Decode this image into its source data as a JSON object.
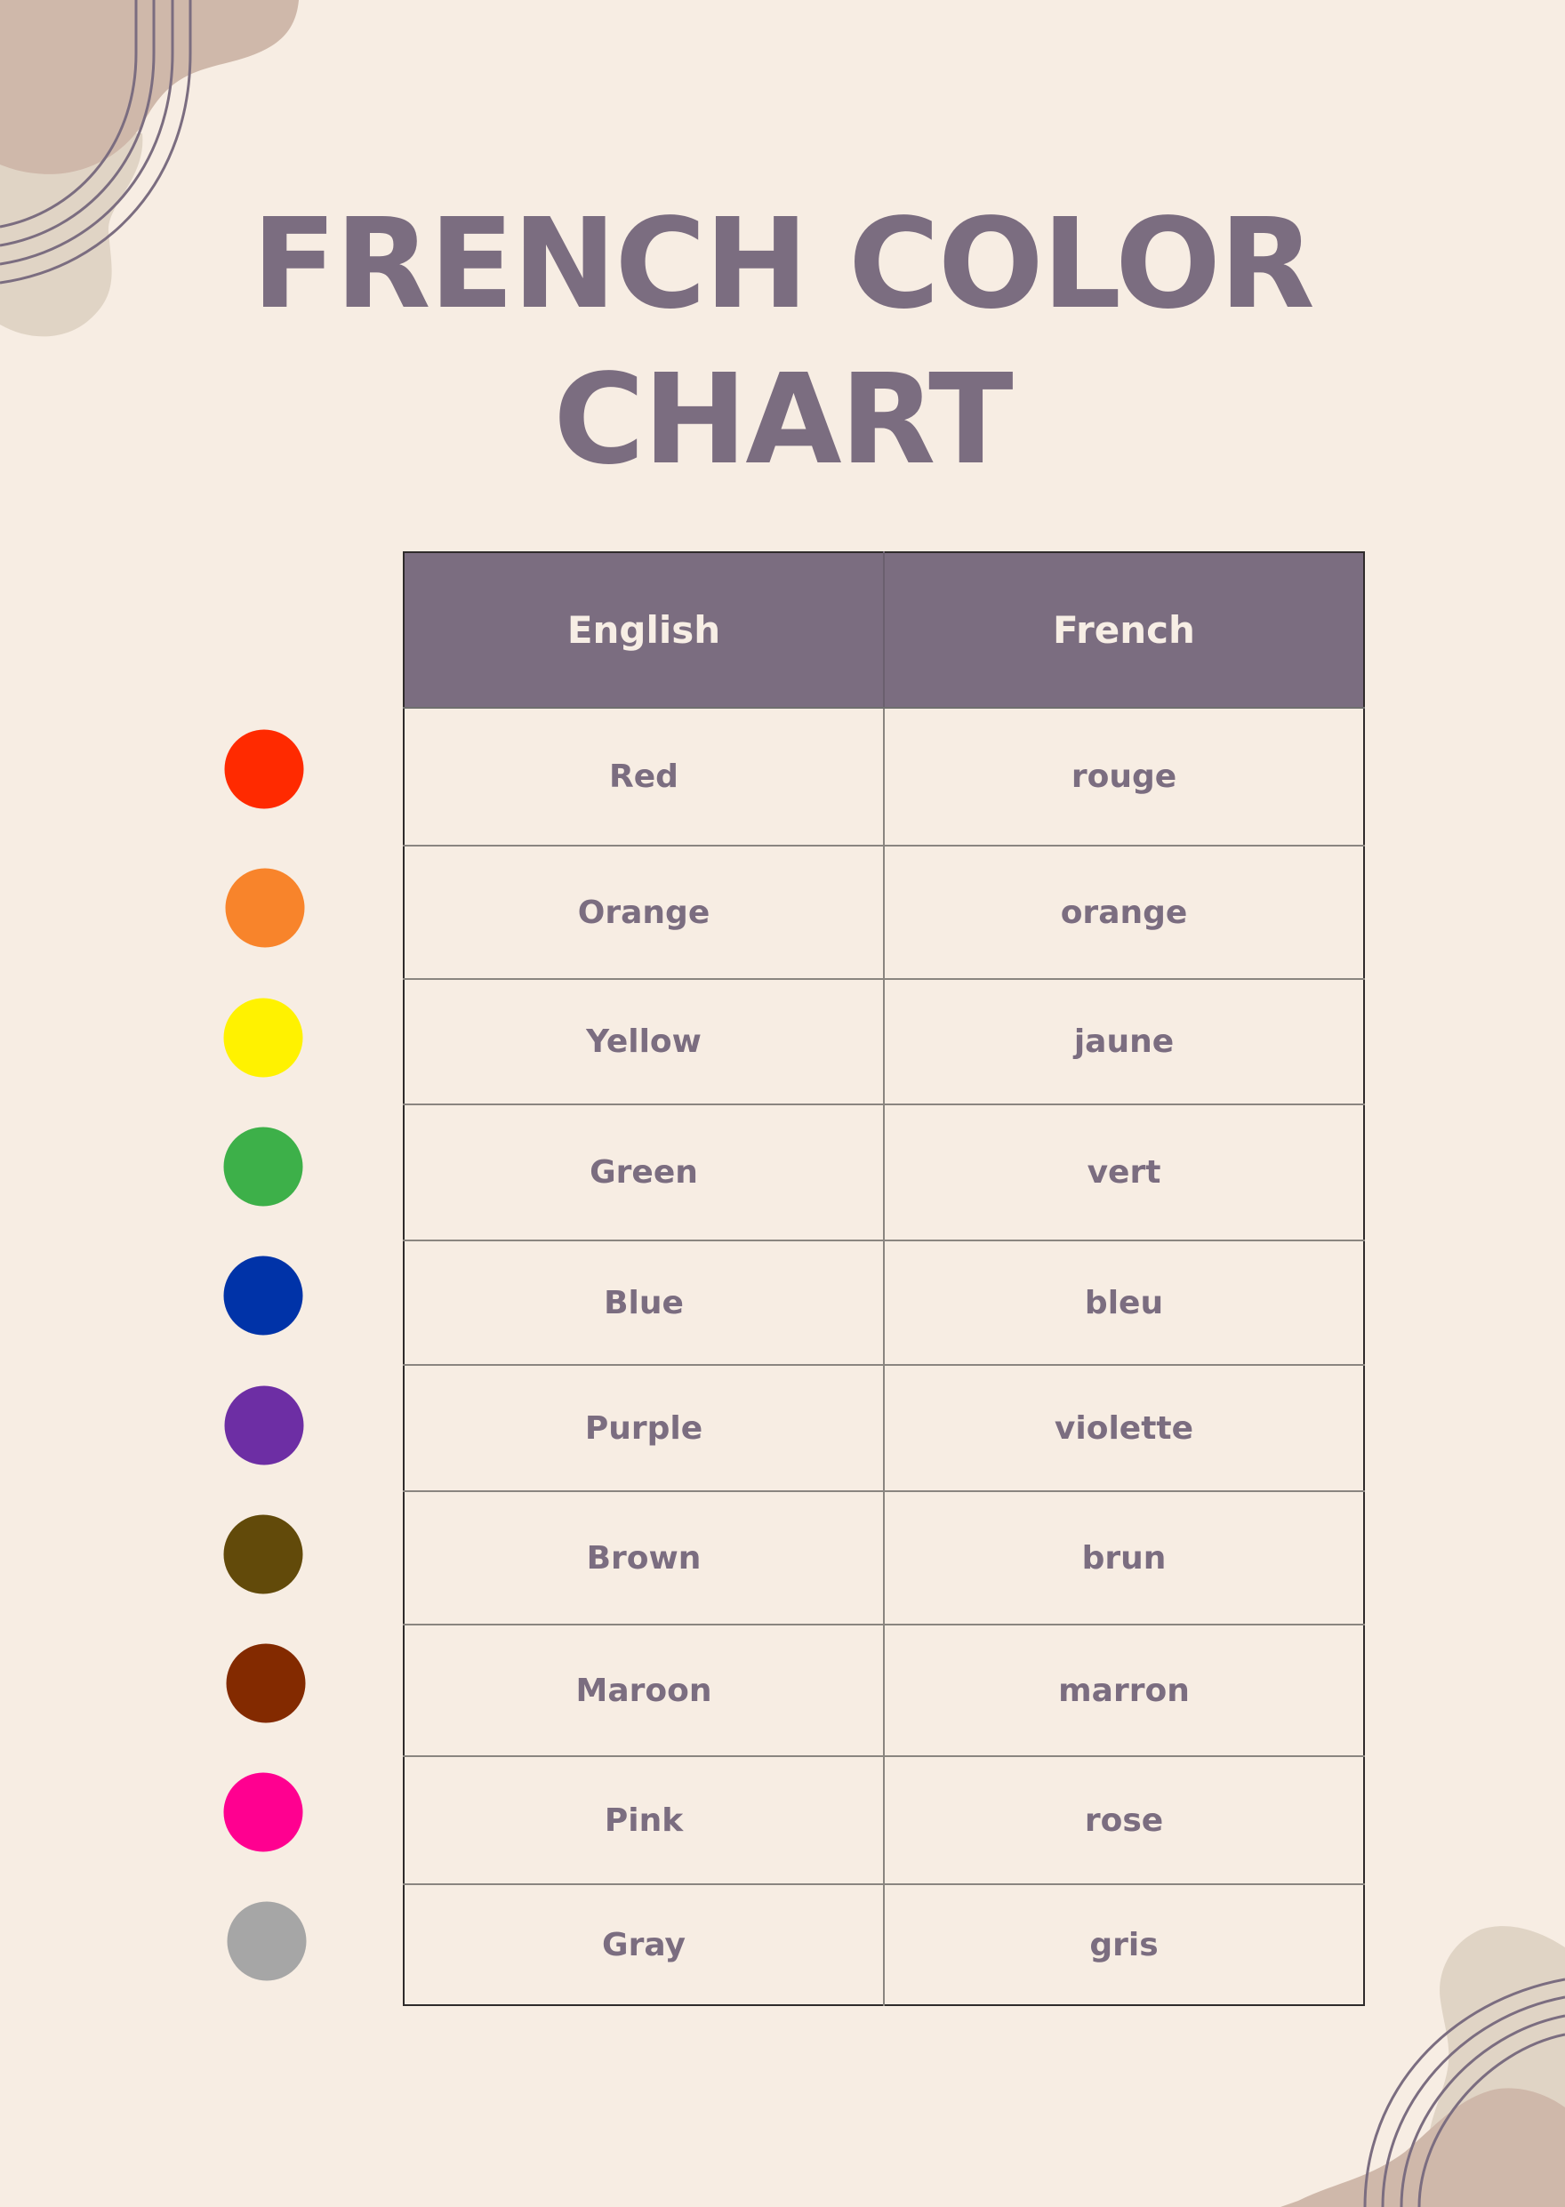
{
  "title": {
    "line1": "FRENCH COLOR",
    "line2": "CHART"
  },
  "table": {
    "headers": {
      "english": "English",
      "french": "French"
    },
    "rows": [
      {
        "english": "Red",
        "french": "rouge",
        "swatch_color": "#FF2A00"
      },
      {
        "english": "Orange",
        "french": "orange",
        "swatch_color": "#F8842B"
      },
      {
        "english": "Yellow",
        "french": "jaune",
        "swatch_color": "#FFF200"
      },
      {
        "english": "Green",
        "french": "vert",
        "swatch_color": "#3DB049"
      },
      {
        "english": "Blue",
        "french": "bleu",
        "swatch_color": "#0033A8"
      },
      {
        "english": "Purple",
        "french": "violette",
        "swatch_color": "#6D2EA4"
      },
      {
        "english": "Brown",
        "french": "brun",
        "swatch_color": "#624A0A"
      },
      {
        "english": "Maroon",
        "french": "marron",
        "swatch_color": "#832A00"
      },
      {
        "english": "Pink",
        "french": "rose",
        "swatch_color": "#FF0090"
      },
      {
        "english": "Gray",
        "french": "gris",
        "swatch_color": "#A6A6A6"
      }
    ]
  },
  "theme": {
    "background": "#F7EDE3",
    "accent": "#7B6D80",
    "header_text": "#F7EEE5",
    "blob_dark": "#CFB8AA",
    "blob_light": "#E0D4C5"
  }
}
